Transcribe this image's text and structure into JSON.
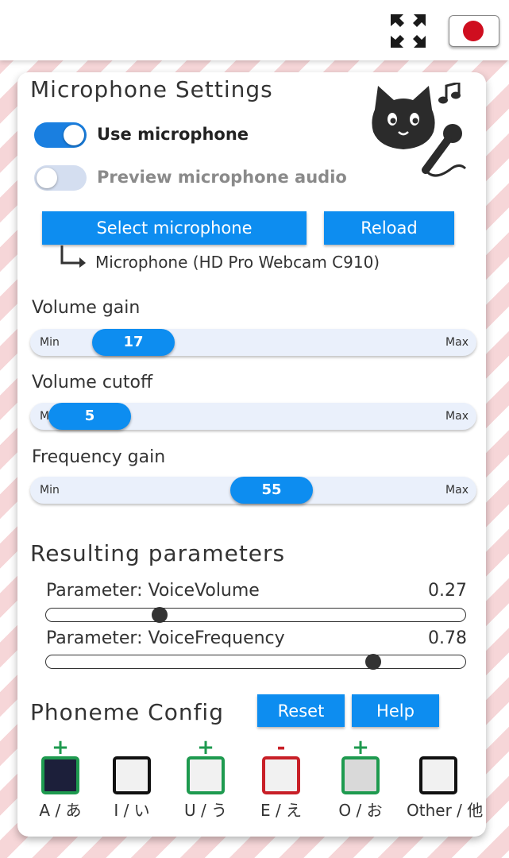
{
  "topbar": {
    "fullscreen_icon": "fullscreen-arrows-icon",
    "language_flag": "japan-flag-icon"
  },
  "colors": {
    "accent": "#0d8df0",
    "toggle_on": "#1a7fe0",
    "plus": "#1e9a4f",
    "minus": "#c81f27",
    "flag_red": "#cf0e1f"
  },
  "mic": {
    "title": "Microphone Settings",
    "use_label": "Use microphone",
    "use_on": true,
    "preview_label": "Preview microphone audio",
    "preview_on": false,
    "select_button": "Select microphone",
    "reload_button": "Reload",
    "device": "Microphone (HD Pro Webcam C910)",
    "mascot_icon": "cat-with-microphone-icon"
  },
  "sliders": [
    {
      "label": "Volume gain",
      "value": "17",
      "min_label": "Min",
      "max_label": "Max"
    },
    {
      "label": "Volume cutoff",
      "value": "5",
      "min_label": "Min",
      "max_label": "Max"
    },
    {
      "label": "Frequency gain",
      "value": "55",
      "min_label": "Min",
      "max_label": "Max"
    }
  ],
  "results": {
    "title": "Resulting parameters",
    "params": [
      {
        "label": "Parameter:  VoiceVolume",
        "value": "0.27",
        "level": 0.27
      },
      {
        "label": "Parameter:  VoiceFrequency",
        "value": "0.78",
        "level": 0.78
      }
    ]
  },
  "phoneme": {
    "title": "Phoneme Config",
    "reset_button": "Reset",
    "help_button": "Help",
    "items": [
      {
        "label": "A / あ",
        "mark": "+",
        "state": "positive",
        "fill": "#1c1f3a"
      },
      {
        "label": "I / い",
        "mark": "",
        "state": "neutral",
        "fill": "#f1f1f1"
      },
      {
        "label": "U / う",
        "mark": "+",
        "state": "positive",
        "fill": "#f1f1f1"
      },
      {
        "label": "E / え",
        "mark": "-",
        "state": "negative",
        "fill": "#f1f1f1"
      },
      {
        "label": "O / お",
        "mark": "+",
        "state": "positive",
        "fill": "#d9d9d9"
      },
      {
        "label": "Other / 他",
        "mark": "",
        "state": "neutral",
        "fill": "#f1f1f1"
      }
    ]
  }
}
